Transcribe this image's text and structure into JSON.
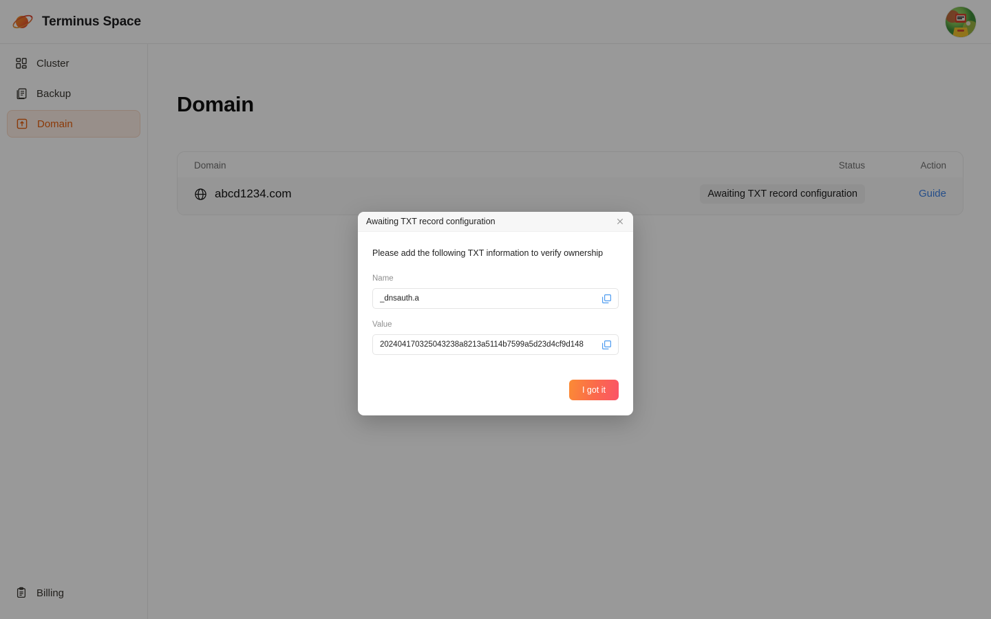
{
  "app": {
    "brand_name": "Terminus Space",
    "logo_icon": "planet-logo",
    "avatar_icon": "user-avatar"
  },
  "sidebar": {
    "items": [
      {
        "id": "cluster",
        "label": "Cluster",
        "icon": "dashboard-grid-icon",
        "active": false
      },
      {
        "id": "backup",
        "label": "Backup",
        "icon": "documents-stack-icon",
        "active": false
      },
      {
        "id": "domain",
        "label": "Domain",
        "icon": "box-arrow-up-icon",
        "active": true
      }
    ],
    "bottom_items": [
      {
        "id": "billing",
        "label": "Billing",
        "icon": "clipboard-list-icon",
        "active": false
      }
    ]
  },
  "main": {
    "page_title": "Domain",
    "table": {
      "headers": {
        "domain": "Domain",
        "status": "Status",
        "action": "Action"
      },
      "rows": [
        {
          "domain": "abcd1234.com",
          "domain_icon": "globe-icon",
          "status": "Awaiting TXT record configuration",
          "action": "Guide"
        }
      ]
    }
  },
  "modal": {
    "title": "Awaiting TXT record configuration",
    "close_icon": "close-icon",
    "description": "Please add the following TXT information to verify ownership",
    "fields": [
      {
        "label": "Name",
        "value": "_dnsauth.a",
        "copy_icon": "copy-icon"
      },
      {
        "label": "Value",
        "value": "202404170325043238a8213a5114b7599a5d23d4cf9d148",
        "copy_icon": "copy-icon"
      }
    ],
    "confirm_label": "I got it"
  },
  "colors": {
    "accent": "#e8600c",
    "accent_bg": "#fdeee6",
    "link": "#3e83e6",
    "copy_icon": "#4d9bf0",
    "button_gradient_start": "#fb8b35",
    "button_gradient_end": "#fb5368",
    "overlay": "rgba(0,0,0,0.40)"
  }
}
